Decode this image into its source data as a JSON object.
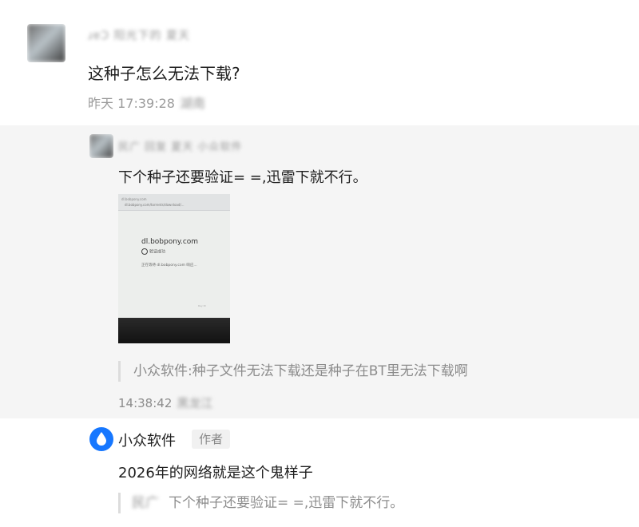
{
  "comment1": {
    "author_name": "ɹɐϽ 阳光下的 夏天",
    "text": "这种子怎么无法下载?",
    "time": "昨天 17:39:28",
    "location": "湖南"
  },
  "reply": {
    "author_name": "民广 回复 夏天 小众软件",
    "text": "下个种子还要验证= =,迅雷下就不行。",
    "image": {
      "browser_tab": "dl.bobpony.com",
      "url": "dl.bobpony.com/torrents/download/...",
      "domain": "dl.bobpony.com",
      "check_label": "验证成功",
      "description": "正在等待 dl.bobpony.com 响应...",
      "footer": "Ray ID"
    },
    "quote": "小众软件:种子文件无法下载还是种子在BT里无法下载啊",
    "time": "14:38:42",
    "location": "黑龙江"
  },
  "author_reply": {
    "author_name": "小众软件",
    "badge": "作者",
    "text": "2026年的网络就是这个鬼样子",
    "quote_author": "民广",
    "quote_text": "下个种子还要验证= =,迅雷下就不行。",
    "avatar_icon": "water-drop-icon",
    "accent_color": "#1677ff"
  }
}
